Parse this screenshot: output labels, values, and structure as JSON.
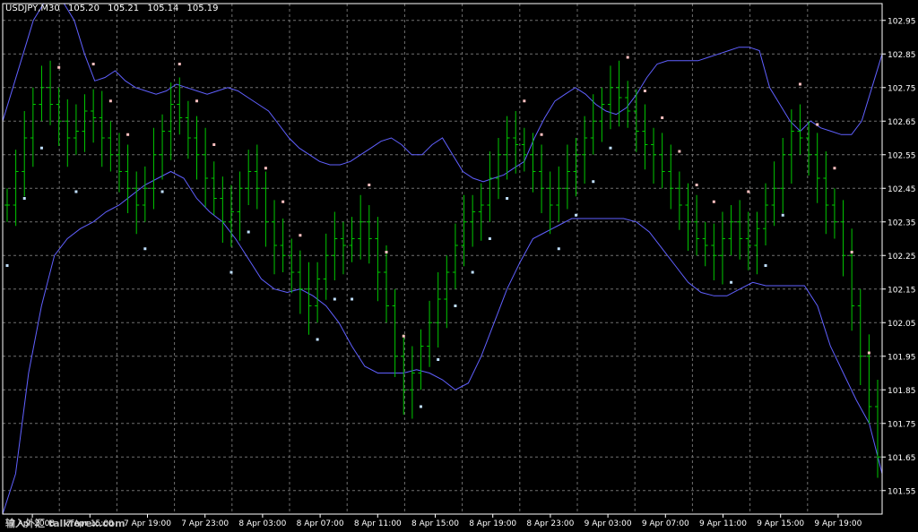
{
  "header": {
    "symbol": "USDJPY,M30",
    "open": "105.20",
    "high": "105.21",
    "low": "105.14",
    "close": "105.19"
  },
  "watermark": "输入外汇 talkforex.com",
  "chart_data": {
    "type": "ohlc",
    "title": "USDJPY,M30",
    "ylim": [
      101.48,
      103.0
    ],
    "grid": true,
    "y_ticks": [
      "102.95",
      "102.85",
      "102.75",
      "102.65",
      "102.55",
      "102.45",
      "102.35",
      "102.25",
      "102.15",
      "102.05",
      "101.95",
      "101.85",
      "101.75",
      "101.65",
      "101.55"
    ],
    "x_ticks": [
      "7 Apr 2008",
      "7 Apr 15:00",
      "7 Apr 19:00",
      "7 Apr 23:00",
      "8 Apr 03:00",
      "8 Apr 07:00",
      "8 Apr 11:00",
      "8 Apr 15:00",
      "8 Apr 19:00",
      "8 Apr 23:00",
      "9 Apr 03:00",
      "9 Apr 07:00",
      "9 Apr 11:00",
      "9 Apr 15:00",
      "9 Apr 19:00"
    ],
    "colors": {
      "bars": "#00c800",
      "bands": "#6060ff",
      "dots_up": "#ffc0c0",
      "dots_down": "#c0e0ff",
      "grid": "#707070",
      "axis": "#ffffff"
    },
    "close": [
      102.4,
      102.5,
      102.6,
      102.7,
      102.75,
      102.7,
      102.65,
      102.6,
      102.62,
      102.68,
      102.66,
      102.6,
      102.55,
      102.5,
      102.45,
      102.4,
      102.45,
      102.55,
      102.62,
      102.7,
      102.66,
      102.6,
      102.55,
      102.48,
      102.42,
      102.35,
      102.38,
      102.45,
      102.5,
      102.45,
      102.35,
      102.28,
      102.25,
      102.2,
      102.15,
      102.1,
      102.18,
      102.25,
      102.3,
      102.28,
      102.3,
      102.35,
      102.3,
      102.2,
      102.1,
      101.95,
      101.85,
      101.9,
      101.98,
      102.05,
      102.12,
      102.2,
      102.28,
      102.35,
      102.38,
      102.4,
      102.48,
      102.55,
      102.6,
      102.58,
      102.55,
      102.5,
      102.45,
      102.4,
      102.45,
      102.5,
      102.55,
      102.6,
      102.65,
      102.7,
      102.75,
      102.72,
      102.68,
      102.62,
      102.58,
      102.55,
      102.5,
      102.45,
      102.4,
      102.35,
      102.3,
      102.28,
      102.25,
      102.3,
      102.35,
      102.3,
      102.28,
      102.33,
      102.4,
      102.45,
      102.55,
      102.62,
      102.6,
      102.55,
      102.48,
      102.4,
      102.35,
      102.25,
      102.1,
      101.95,
      101.8,
      101.65
    ],
    "bb_upper": [
      102.65,
      102.75,
      102.85,
      102.95,
      103.05,
      103.1,
      103.05,
      102.95,
      102.85,
      102.77,
      102.78,
      102.8,
      102.77,
      102.75,
      102.74,
      102.73,
      102.74,
      102.76,
      102.75,
      102.74,
      102.73,
      102.74,
      102.75,
      102.74,
      102.72,
      102.7,
      102.68,
      102.64,
      102.6,
      102.57,
      102.55,
      102.53,
      102.52,
      102.52,
      102.53,
      102.55,
      102.57,
      102.59,
      102.6,
      102.58,
      102.55,
      102.55,
      102.58,
      102.6,
      102.55,
      102.5,
      102.48,
      102.47,
      102.48,
      102.49,
      102.51,
      102.53,
      102.6,
      102.66,
      102.71,
      102.73,
      102.75,
      102.73,
      102.7,
      102.68,
      102.67,
      102.69,
      102.73,
      102.78,
      102.82,
      102.83,
      102.83,
      102.83,
      102.83,
      102.84,
      102.85,
      102.86,
      102.87,
      102.87,
      102.86,
      102.75,
      102.7,
      102.65,
      102.62,
      102.65,
      102.63,
      102.62,
      102.61,
      102.61,
      102.65,
      102.75,
      102.85
    ],
    "bb_lower": [
      101.4,
      101.6,
      101.9,
      102.1,
      102.25,
      102.3,
      102.33,
      102.35,
      102.38,
      102.4,
      102.43,
      102.46,
      102.48,
      102.5,
      102.48,
      102.42,
      102.38,
      102.35,
      102.3,
      102.24,
      102.18,
      102.15,
      102.14,
      102.15,
      102.13,
      102.1,
      102.05,
      101.98,
      101.92,
      101.9,
      101.9,
      101.9,
      101.91,
      101.9,
      101.88,
      101.85,
      101.87,
      101.95,
      102.05,
      102.15,
      102.23,
      102.3,
      102.32,
      102.34,
      102.36,
      102.36,
      102.36,
      102.36,
      102.36,
      102.35,
      102.32,
      102.27,
      102.22,
      102.17,
      102.14,
      102.13,
      102.13,
      102.15,
      102.17,
      102.16,
      102.16,
      102.16,
      102.16,
      102.1,
      101.98,
      101.9,
      101.82,
      101.75,
      101.6
    ]
  }
}
